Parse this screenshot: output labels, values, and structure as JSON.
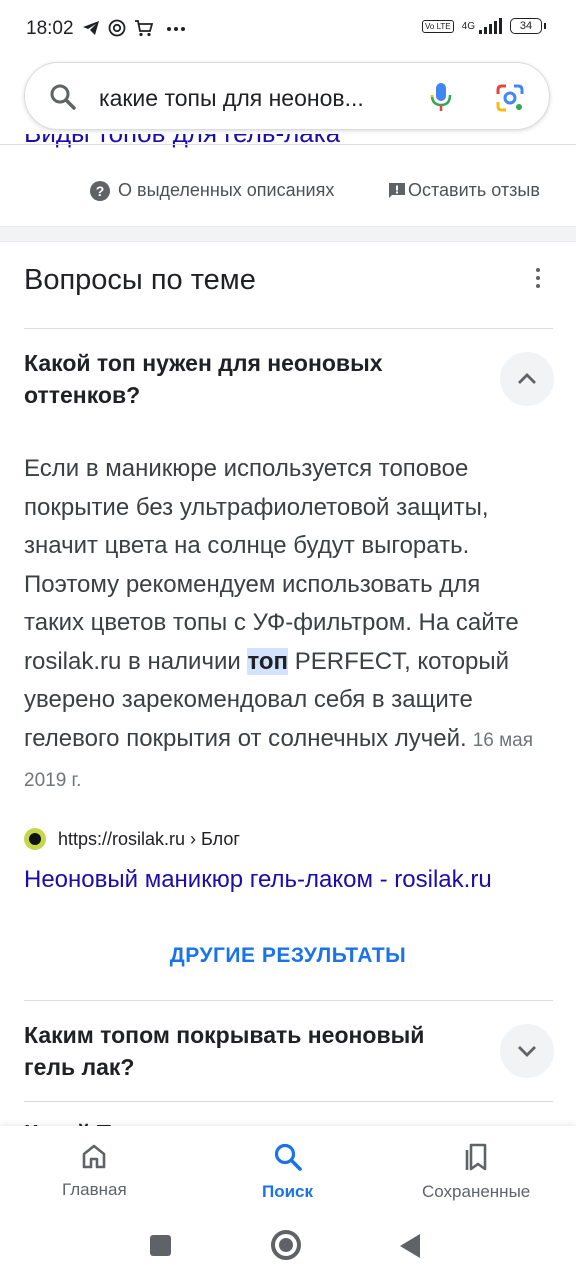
{
  "status_bar": {
    "time": "18:02",
    "left_icons": [
      "telegram-icon",
      "at-sign-icon",
      "cart-icon",
      "more-icon"
    ],
    "volte": "Vo LTE",
    "network": "4G",
    "battery": "34"
  },
  "search": {
    "query": "какие топы для неонов..."
  },
  "top_cutoff_link": "Виды топов для гель-лака",
  "featured_feedback": {
    "about_label": "О выделенных описаниях",
    "leave_label": "Оставить отзыв"
  },
  "related_questions": {
    "title": "Вопросы по теме",
    "expanded": {
      "question": "Какой топ нужен для неоновых оттенков?",
      "answer_before": "Если в маникюре используется топовое покрытие без ультрафиолетовой защиты, значит цвета на солнце будут выгорать. Поэтому рекомендуем использовать для таких цветов топы с УФ-фильтром. На сайте rosilak.ru в наличии ",
      "answer_highlight": "топ",
      "answer_after": " PERFECT, который уверено зарекомендовал себя в защите гелевого покрытия от солнечных лучей.",
      "date": "16 мая 2019 г.",
      "source_url": "https://rosilak.ru › Блог",
      "result_title": "Неоновый маникюр гель-лаком - rosilak.ru",
      "more_results": "ДРУГИЕ РЕЗУЛЬТАТЫ"
    },
    "collapsed": [
      {
        "question": "Каким топом покрывать неоновый гель лак?"
      },
      {
        "question": "Какой Топ"
      }
    ]
  },
  "bottom_nav": {
    "items": [
      {
        "label": "Главная",
        "icon": "home-icon"
      },
      {
        "label": "Поиск",
        "icon": "search-icon"
      },
      {
        "label": "Сохраненные",
        "icon": "bookmarks-icon"
      }
    ],
    "active": "Поиск"
  },
  "colors": {
    "link": "#1a0dab",
    "accent": "#1a73e8",
    "highlight": "#d3e3fd"
  }
}
